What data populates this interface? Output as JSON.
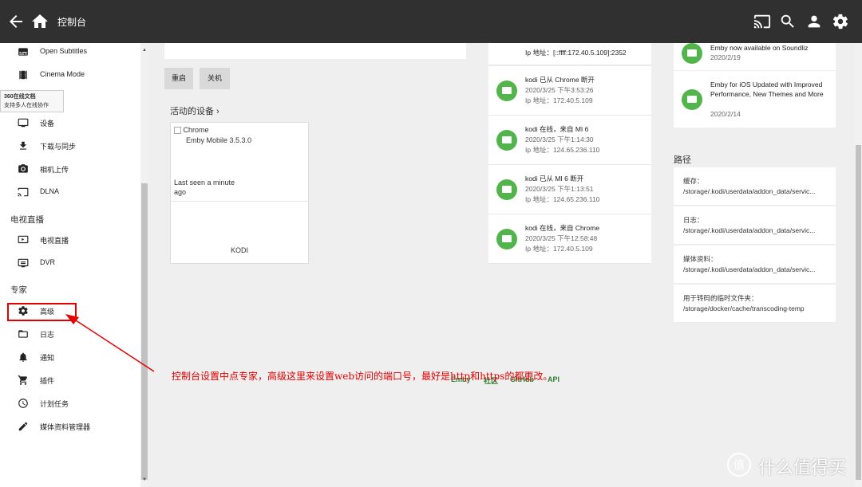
{
  "header": {
    "title": "控制台",
    "icons": [
      "back-arrow-icon",
      "home-icon",
      "cast-icon",
      "search-icon",
      "user-icon",
      "gear-icon"
    ]
  },
  "sidebar": {
    "items_top": [
      {
        "label": "Open Subtitles",
        "icon": "subtitles-icon"
      },
      {
        "label": "Cinema Mode",
        "icon": "cinema-icon"
      }
    ],
    "tooltip": {
      "line1": "360在线文档",
      "line2": "支持多人在线协作"
    },
    "items_mid": [
      {
        "label": "设备",
        "icon": "device-icon"
      },
      {
        "label": "下载与同步",
        "icon": "download-icon"
      },
      {
        "label": "相机上传",
        "icon": "camera-icon"
      },
      {
        "label": "DLNA",
        "icon": "dlna-icon"
      }
    ],
    "section_live": "电视直播",
    "items_live": [
      {
        "label": "电视直播",
        "icon": "live-tv-icon"
      },
      {
        "label": "DVR",
        "icon": "dvr-icon"
      }
    ],
    "section_expert": "专家",
    "items_expert": [
      {
        "label": "高级",
        "icon": "gear-icon"
      },
      {
        "label": "日志",
        "icon": "folder-icon"
      },
      {
        "label": "通知",
        "icon": "bell-icon"
      },
      {
        "label": "插件",
        "icon": "cart-icon"
      },
      {
        "label": "计划任务",
        "icon": "clock-icon"
      },
      {
        "label": "媒体资料管理器",
        "icon": "pencil-icon"
      }
    ]
  },
  "server": {
    "restart_label": "重启",
    "shutdown_label": "关机"
  },
  "devices": {
    "title": "活动的设备 ›",
    "card": {
      "client": "Chrome",
      "app": "Emby Mobile 3.5.3.0",
      "last_seen_1": "Last seen a minute",
      "last_seen_2": "ago",
      "device_name": "KODI"
    }
  },
  "activity": [
    {
      "title": "",
      "time": "",
      "ip": "Ip 地址：[::ffff:172.40.5.109]:2352"
    },
    {
      "title": "kodi 已从 Chrome 断开",
      "time": "2020/3/25 下午3:53:26",
      "ip": "Ip 地址：172.40.5.109"
    },
    {
      "title": "kodi 在线，来自 MI 6",
      "time": "2020/3/25 下午1:14:30",
      "ip": "Ip 地址：124.65.236.110"
    },
    {
      "title": "kodi 已从 MI 6 断开",
      "time": "2020/3/25 下午1:13:51",
      "ip": "Ip 地址：124.65.236.110"
    },
    {
      "title": "kodi 在线，来自 Chrome",
      "time": "2020/3/25 下午12:58:48",
      "ip": "Ip 地址：172.40.5.109"
    }
  ],
  "news": [
    {
      "text": "Emby now available on Soundliz",
      "date": "2020/2/19"
    },
    {
      "text": "Emby for iOS Updated with Improved Performance, New Themes and More",
      "date": "2020/2/14"
    }
  ],
  "paths": {
    "title": "路径",
    "rows": [
      {
        "key": "缓存：",
        "value": "/storage/.kodi/userdata/addon_data/servic..."
      },
      {
        "key": "日志：",
        "value": "/storage/.kodi/userdata/addon_data/servic..."
      },
      {
        "key": "媒体资料：",
        "value": "/storage/.kodi/userdata/addon_data/servic..."
      },
      {
        "key": "用于转码的临时文件夹：",
        "value": "/storage/docker/cache/transcoding-temp"
      }
    ]
  },
  "footer_links": [
    "Emby",
    "社区",
    "GitHub",
    "API"
  ],
  "annotation": "控制台设置中点专家，高级这里来设置web访问的端口号，最好是http和https的都更改。",
  "watermark": "值 | 什么值得买",
  "colors": {
    "accent": "#52b54b",
    "header": "#303030",
    "annotation": "#e60000"
  }
}
